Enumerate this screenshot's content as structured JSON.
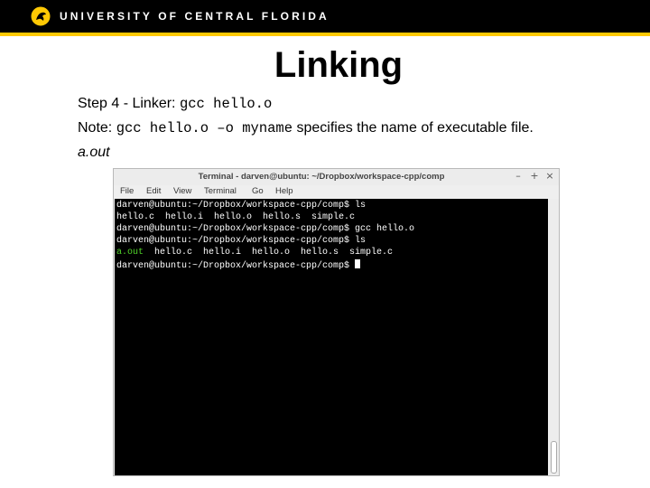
{
  "header": {
    "university_name": "UNIVERSITY OF CENTRAL FLORIDA",
    "logo_icon": "pegasus-logo-icon",
    "accent_color": "#ffc904"
  },
  "slide": {
    "title": "Linking",
    "step_label": "Step 4 - Linker: ",
    "step_command": "gcc hello.o",
    "note_label": "Note: ",
    "note_command": "gcc hello.o –o myname",
    "note_text": " specifies the name of executable file.",
    "default_output": "a.out"
  },
  "terminal": {
    "title": "Terminal - darven@ubuntu: ~/Dropbox/workspace-cpp/comp",
    "buttons": [
      "–",
      "+",
      "×"
    ],
    "menu": [
      "File",
      "Edit",
      "View",
      "Terminal",
      "Go",
      "Help"
    ],
    "lines": [
      {
        "prompt": "darven@ubuntu:~/Dropbox/workspace-cpp/comp$ ",
        "command": "ls"
      },
      {
        "output": "hello.c  hello.i  hello.o  hello.s  simple.c"
      },
      {
        "prompt": "darven@ubuntu:~/Dropbox/workspace-cpp/comp$ ",
        "command": "gcc hello.o"
      },
      {
        "prompt": "darven@ubuntu:~/Dropbox/workspace-cpp/comp$ ",
        "command": "ls"
      },
      {
        "highlight": "a.out",
        "output": "  hello.c  hello.i  hello.o  hello.s  simple.c"
      },
      {
        "prompt": "darven@ubuntu:~/Dropbox/workspace-cpp/comp$ ",
        "command": ""
      }
    ],
    "highlight_color": "#52d62a"
  }
}
